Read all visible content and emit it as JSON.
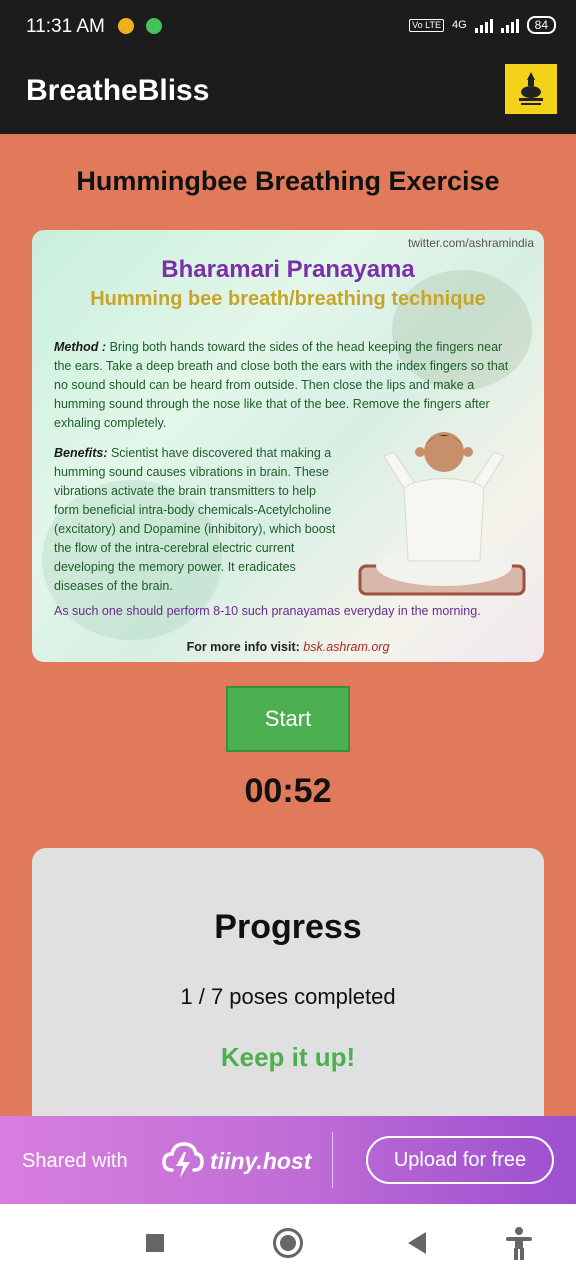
{
  "status_bar": {
    "time": "11:31 AM",
    "network": "4G",
    "volte": "Vo LTE",
    "battery": "84"
  },
  "app_bar": {
    "title": "BreatheBliss"
  },
  "page": {
    "title": "Hummingbee Breathing Exercise"
  },
  "illustration": {
    "handle": "twitter.com/ashramindia",
    "title": "Bharamari Pranayama",
    "subtitle": "Humming bee breath/breathing technique",
    "method_label": "Method :",
    "method_text": "Bring both hands toward the sides of the head keeping the fingers near the ears. Take a deep breath and close both the ears with the index fingers so that no sound should can be heard from outside. Then close the lips and make a humming sound through the nose like that of the bee. Remove the fingers after exhaling completely.",
    "benefits_label": "Benefits:",
    "benefits_text": "Scientist have discovered that making a humming sound causes vibrations in brain. These vibrations activate the brain transmitters to help form beneficial intra-body chemicals-Acetylcholine (excitatory) and Dopamine (inhibitory), which boost the flow of the intra-cerebral electric current developing the memory power. It eradicates diseases of the brain.",
    "advice": "As such one should perform 8-10 such pranayamas everyday in the morning.",
    "info_label": "For more info visit:",
    "info_url": "bsk.ashram.org"
  },
  "controls": {
    "start_label": "Start",
    "timer": "00:52"
  },
  "progress": {
    "title": "Progress",
    "count": "1 / 7 poses completed",
    "message": "Keep it up!"
  },
  "share_banner": {
    "shared_with": "Shared with",
    "brand": "tiiny.host",
    "upload_label": "Upload for free"
  },
  "colors": {
    "background": "#e07a5a",
    "app_bar": "#1c1c1c",
    "start_button": "#4caf50",
    "encouragement": "#4caf50",
    "progress_card": "#e0e0e0",
    "banner_gradient_start": "#d97ee0",
    "banner_gradient_end": "#9c4fcf"
  }
}
